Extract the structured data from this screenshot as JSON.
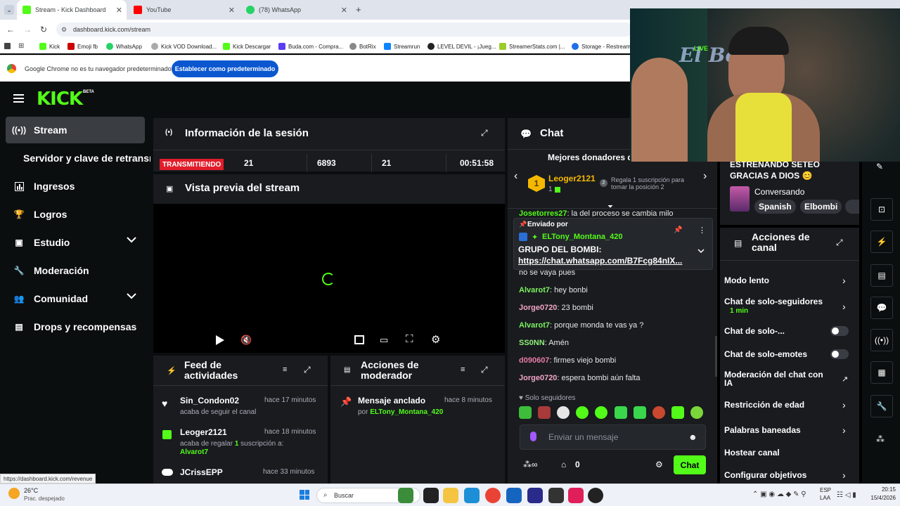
{
  "tabs": [
    {
      "label": "Stream - Kick Dashboard",
      "active": true
    },
    {
      "label": "YouTube"
    },
    {
      "label": "(78) WhatsApp"
    }
  ],
  "address": "dashboard.kick.com/stream",
  "bookmarks": [
    "Kick",
    "Emoji fb",
    "WhatsApp",
    "Kick VOD Download...",
    "Kick Descargar",
    "Buda.com - Compra...",
    "BotRix",
    "Streamrun",
    "LEVEL DEVIL - ¡Jueg...",
    "StreamerStats.com |...",
    "Storage - Restream"
  ],
  "notice": {
    "text": "Google Chrome no es tu navegador predeterminado",
    "button": "Establecer como predeterminado"
  },
  "brand": {
    "logo": "KICK",
    "badge": "BETA"
  },
  "sidebar": [
    {
      "label": "Stream",
      "icon": "broadcast-icon"
    },
    {
      "label": "Servidor y clave de retransmisión",
      "icon": ""
    },
    {
      "label": "Ingresos",
      "icon": "chart-icon"
    },
    {
      "label": "Logros",
      "icon": "trophy-icon"
    },
    {
      "label": "Estudio",
      "icon": "studio-icon"
    },
    {
      "label": "Moderación",
      "icon": "wrench-icon"
    },
    {
      "label": "Comunidad",
      "icon": "community-icon"
    },
    {
      "label": "Drops y recompensas",
      "icon": "drops-icon"
    }
  ],
  "session": {
    "title": "Información de la sesión",
    "status": "TRANSMITIENDO",
    "viewers": "21",
    "followers": "6893",
    "subs": "21",
    "duration": "00:51:58"
  },
  "preview": {
    "title": "Vista previa del stream"
  },
  "feed": {
    "title": "Feed de actividades",
    "items": [
      {
        "user": "Sin_Condon02",
        "time": "hace 17 minutos",
        "pre": "acaba de seguir el canal",
        "count": "",
        "post": "",
        "target": ""
      },
      {
        "user": "Leoger2121",
        "time": "hace 18 minutos",
        "pre": "acaba de regalar ",
        "count": "1",
        "post": " suscripción a:",
        "target": "Alvarot7"
      },
      {
        "user": "JCrissEPP",
        "time": "hace 33 minutos",
        "pre": "",
        "count": "",
        "post": "",
        "target": ""
      }
    ]
  },
  "modactions": {
    "title": "Acciones de moderador",
    "items": [
      {
        "title": "Mensaje anclado",
        "time": "hace 8 minutos",
        "by": "por",
        "user": "ELTony_Montana_420"
      }
    ]
  },
  "chat": {
    "title": "Chat",
    "donors_title": "Mejores donadores d",
    "donor": {
      "name": "Leoger2121",
      "count": "1",
      "rank": "1",
      "hint_num": "2",
      "hint": "Regala 1 suscripción para tomar la posición 2"
    },
    "partial_line": {
      "user": "Josetorres27",
      "text": "la del proceso se cambia milo"
    },
    "pinned": {
      "label": "Enviado por",
      "user": "ELTony_Montana_420",
      "text": "GRUPO DEL BOMBI:",
      "link": "https://chat.whatsapp.com/B7Fcg84nIX..."
    },
    "messages": [
      {
        "user": "",
        "text": "no se vaya pues",
        "color": "#e7e7e7"
      },
      {
        "user": "Alvarot7",
        "text": " hey bonbi",
        "color": "#7cf25f"
      },
      {
        "user": "Jorge0720",
        "text": " 23 bombi",
        "color": "#f3a6c8"
      },
      {
        "user": "Alvarot7",
        "text": " porque monda te vas ya ?",
        "color": "#7cf25f"
      },
      {
        "user": "SS0NN",
        "text": " Amén",
        "color": "#8ff07a"
      },
      {
        "user": "d090607",
        "text": " firmes viejo bombi",
        "color": "#e87ba8"
      },
      {
        "user": "Jorge0720",
        "text": " espera bombi aún falta",
        "color": "#f3a6c8"
      }
    ],
    "mode": "Solo seguidores",
    "placeholder": "Enviar un mensaje",
    "points": "0",
    "send": "Chat"
  },
  "stream_title": "ESTRENANDO SETEO GRACIAS A DIOS 😊",
  "stream_info": {
    "category": "Conversando",
    "tags": [
      "Spanish",
      "Elbombi"
    ]
  },
  "channel_actions": {
    "title": "Acciones de canal",
    "items": [
      {
        "label": "Modo lento",
        "sub": "",
        "control": "chevron"
      },
      {
        "label": "Chat de solo-seguidores",
        "sub": "1 min",
        "control": "chevron"
      },
      {
        "label": "Chat de solo-...",
        "sub": "",
        "control": "toggle"
      },
      {
        "label": "Chat de solo-emotes",
        "sub": "",
        "control": "toggle"
      },
      {
        "label": "Moderación del chat con IA",
        "sub": "",
        "control": "external"
      },
      {
        "label": "Restricción de edad",
        "sub": "",
        "control": "chevron"
      },
      {
        "label": "Palabras baneadas",
        "sub": "",
        "control": "chevron"
      },
      {
        "label": "Hostear canal",
        "sub": "",
        "control": ""
      },
      {
        "label": "Configurar objetivos",
        "sub": "",
        "control": "chevron"
      }
    ]
  },
  "status_url": "https://dashboard.kick.com/revenue",
  "webcam": {
    "overlay": "El Bombi",
    "live": "LIVE"
  },
  "taskbar": {
    "temp": "26°C",
    "weather": "Prac. despejado",
    "search": "Buscar",
    "lang": "ESP",
    "lang2": "LAA",
    "time": "20:15",
    "date": "15/4/2026"
  },
  "colors": {
    "kick_green": "#53fc18",
    "panel": "#191b1f",
    "live_red": "#e11d2a"
  }
}
